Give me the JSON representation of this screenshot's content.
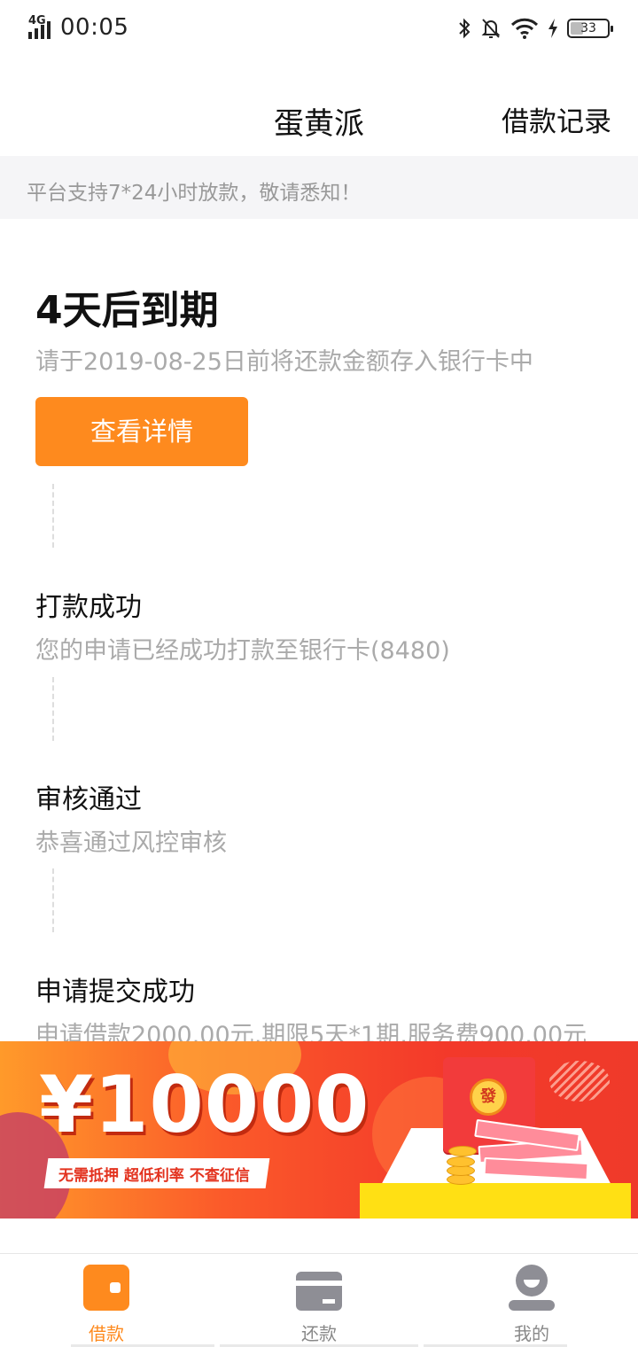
{
  "status_bar": {
    "network": "4G",
    "time": "00:05",
    "battery": "33",
    "icons": [
      "bluetooth-icon",
      "bell-off-icon",
      "wifi-icon",
      "charging-icon"
    ]
  },
  "header": {
    "title": "蛋黄派",
    "record_link": "借款记录"
  },
  "notice": {
    "text": "平台支持7*24小时放款，敬请悉知！"
  },
  "loan_status": {
    "due_title": "4天后到期",
    "due_subtitle": "请于2019-08-25日前将还款金额存入银行卡中",
    "detail_button": "查看详情"
  },
  "timeline": [
    {
      "title": "打款成功",
      "desc": "您的申请已经成功打款至银行卡(8480)"
    },
    {
      "title": "审核通过",
      "desc": "恭喜通过风控审核"
    },
    {
      "title": "申请提交成功",
      "desc": "申请借款2000.00元,期限5天*1期,服务费900.00元"
    }
  ],
  "banner": {
    "amount": "¥10000",
    "tagline": "无需抵押  超低利率  不查征信",
    "envelope_char": "發"
  },
  "bottom_nav": [
    {
      "label": "借款",
      "icon": "wallet-icon",
      "active": true
    },
    {
      "label": "还款",
      "icon": "card-icon",
      "active": false
    },
    {
      "label": "我的",
      "icon": "user-icon",
      "active": false
    }
  ],
  "colors": {
    "accent": "#fe8a1e",
    "banner_red": "#f3392a",
    "muted_text": "#aaaaaa",
    "notice_bg": "#f5f5f7"
  }
}
